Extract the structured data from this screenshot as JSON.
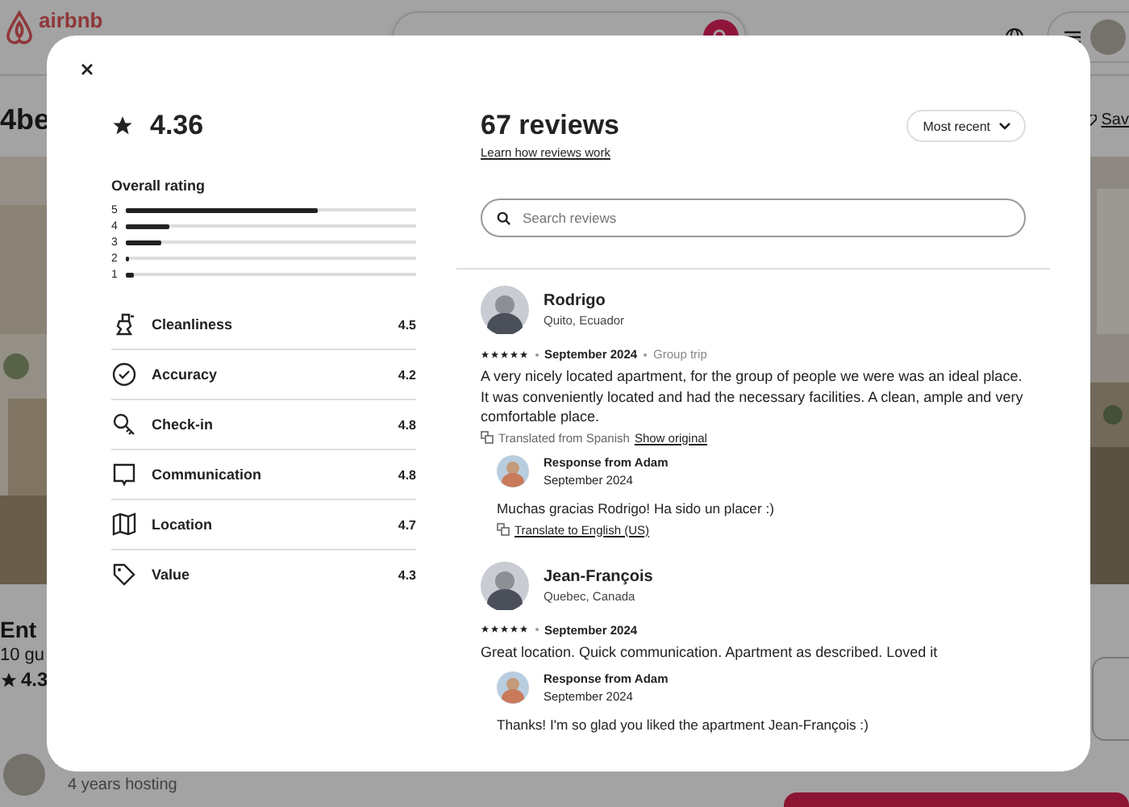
{
  "background": {
    "logo": "airbnb",
    "title": "4be",
    "save": "Sav",
    "listing_type": "Ent",
    "guests": "10 gu",
    "rating": "4.3",
    "host_years": "4 years hosting"
  },
  "modal": {
    "rating": "4.36",
    "reviews_count": "67 reviews",
    "learn_link": "Learn how reviews work",
    "sort": "Most recent",
    "search_placeholder": "Search reviews",
    "overall": {
      "title": "Overall rating",
      "bars": [
        {
          "label": "5",
          "level": 0.66
        },
        {
          "label": "4",
          "level": 0.15
        },
        {
          "label": "3",
          "level": 0.12
        },
        {
          "label": "2",
          "level": 0.01
        },
        {
          "label": "1",
          "level": 0.03
        }
      ]
    },
    "categories": [
      {
        "label": "Cleanliness",
        "score": "4.5"
      },
      {
        "label": "Accuracy",
        "score": "4.2"
      },
      {
        "label": "Check-in",
        "score": "4.8"
      },
      {
        "label": "Communication",
        "score": "4.8"
      },
      {
        "label": "Location",
        "score": "4.7"
      },
      {
        "label": "Value",
        "score": "4.3"
      }
    ],
    "reviews": [
      {
        "name": "Rodrigo",
        "location": "Quito, Ecuador",
        "stars": 5,
        "date": "September 2024",
        "trip": "Group trip",
        "text": "A very nicely located apartment, for the group of people we were was an ideal place. It was conveniently located and had the necessary facilities. A clean, ample and very comfortable place.",
        "translation": {
          "note": "Translated from Spanish",
          "link": "Show original"
        },
        "response": {
          "title": "Response from Adam",
          "date": "September 2024",
          "text": "Muchas gracias Rodrigo! Ha sido un placer :)",
          "link": "Translate to English (US)"
        }
      },
      {
        "name": "Jean-François",
        "location": "Quebec, Canada",
        "stars": 5,
        "date": "September 2024",
        "text": "Great location. Quick communication. Apartment as described. Loved it",
        "response": {
          "title": "Response from Adam",
          "date": "September 2024",
          "text": "Thanks! I'm so glad you liked the apartment Jean-François :)"
        }
      }
    ]
  }
}
